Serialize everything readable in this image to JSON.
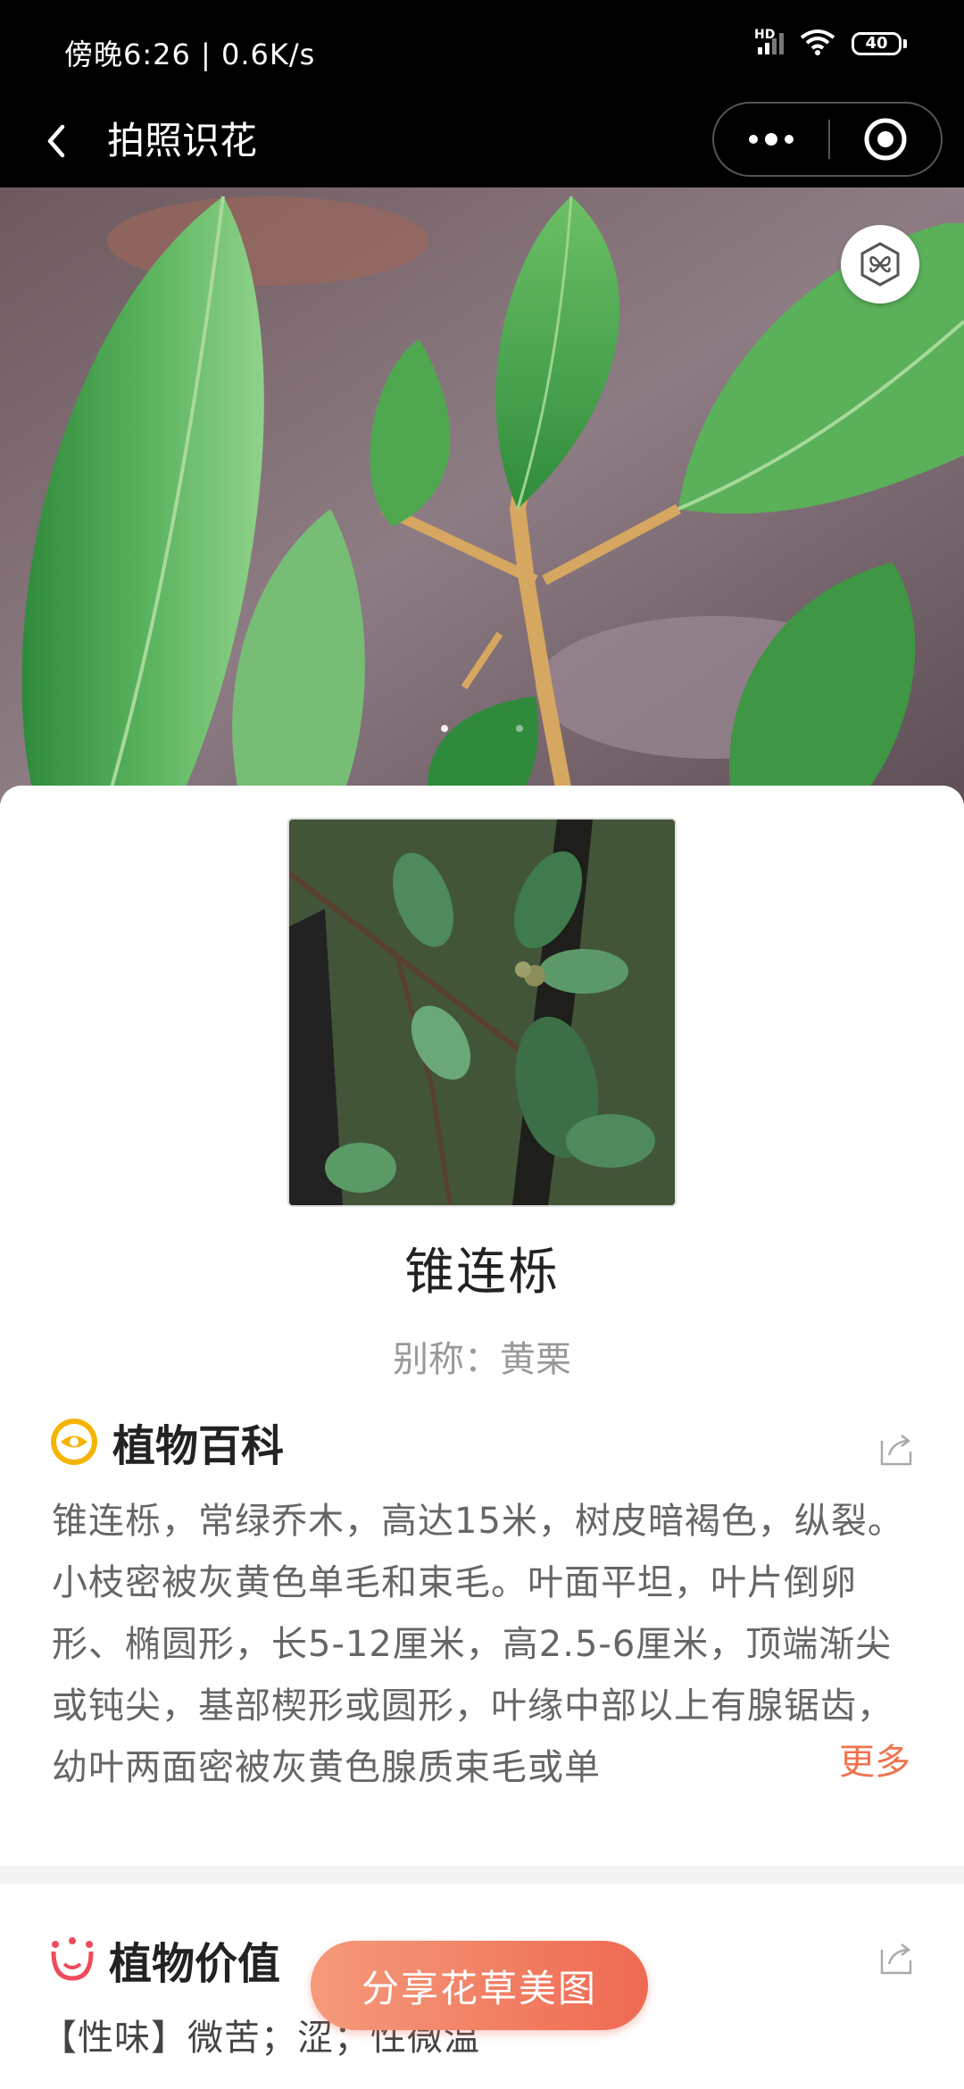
{
  "status_bar": {
    "time": "傍晚6:26",
    "net_speed": "0.6K/s",
    "network": "HD",
    "battery": "40"
  },
  "nav": {
    "title": "拍照识花"
  },
  "plant": {
    "name": "锥连栎",
    "alias": "别称：黄栗"
  },
  "encyclopedia": {
    "heading": "植物百科",
    "text": "锥连栎，常绿乔木，高达15米，树皮暗褐色，纵裂。小枝密被灰黄色单毛和束毛。叶面平坦，叶片倒卵形、椭圆形，长5-12厘米，高2.5-6厘米，顶端渐尖或钝尖，基部楔形或圆形，叶缘中部以上有腺锯齿，幼叶两面密被灰黄色腺质束毛或单",
    "more": "更多"
  },
  "value": {
    "heading": "植物价值",
    "line": "【性味】微苦；涩；性微温"
  },
  "share_button": "分享花草美图",
  "colors": {
    "accent": "#f0724e",
    "eye_icon": "#f5b400",
    "value_icon": "#ef4b5c"
  }
}
